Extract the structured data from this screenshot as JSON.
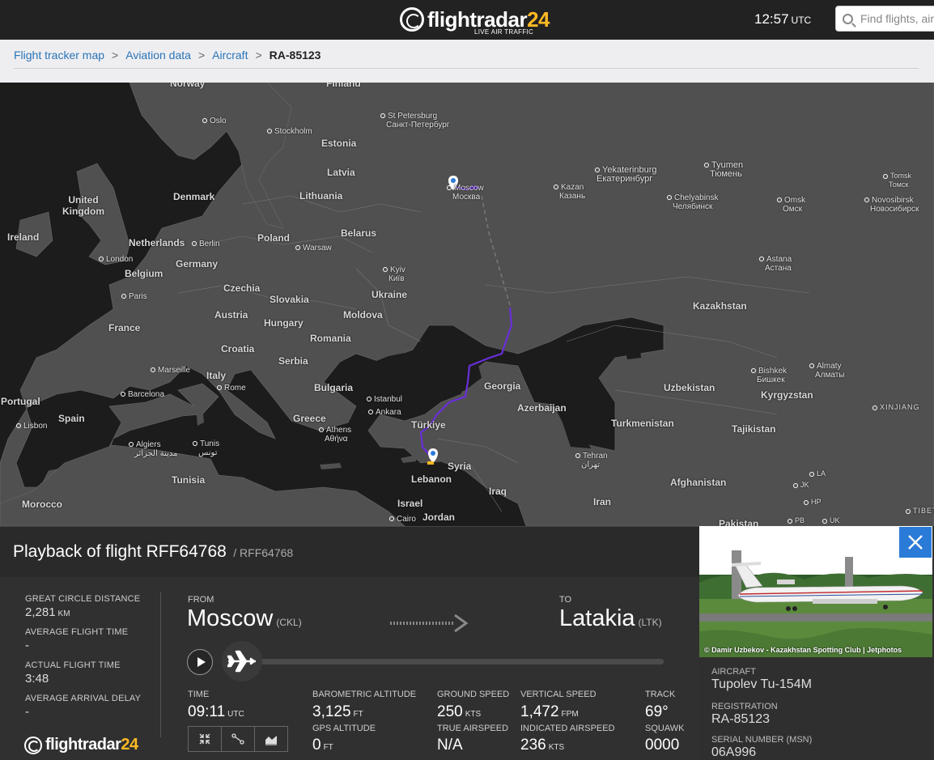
{
  "header": {
    "logo_text": "flightradar",
    "logo_number": "24",
    "logo_tagline": "LIVE AIR TRAFFIC",
    "time": "12:57",
    "time_zone": "UTC",
    "search_placeholder": "Find flights, airports"
  },
  "breadcrumb": {
    "items": [
      "Flight tracker map",
      "Aviation data",
      "Aircraft"
    ],
    "current": "RA-85123",
    "separator": ">"
  },
  "map": {
    "countries": [
      "Norway",
      "Finland",
      "Estonia",
      "Latvia",
      "Lithuania",
      "United Kingdom",
      "Denmark",
      "Ireland",
      "Netherlands",
      "Belarus",
      "Poland",
      "Germany",
      "Belgium",
      "Czechia",
      "Slovakia",
      "Ukraine",
      "France",
      "Austria",
      "Hungary",
      "Moldova",
      "Romania",
      "Croatia",
      "Serbia",
      "Italy",
      "Bulgaria",
      "Georgia",
      "Portugal",
      "Spain",
      "Greece",
      "Türkiye",
      "Azerbaijan",
      "Syria",
      "Lebanon",
      "Iraq",
      "Israel",
      "Jordan",
      "Iran",
      "Tunisia",
      "Morocco",
      "Kazakhstan",
      "Uzbekistan",
      "Kyrgyzstan",
      "Turkmenistan",
      "Tajikistan",
      "Afghanistan",
      "Pakistan"
    ],
    "cities": [
      {
        "name": "Oslo"
      },
      {
        "name": "Stockholm"
      },
      {
        "name": "St Petersburg",
        "local": "Санкт-Петербург"
      },
      {
        "name": "Moscow",
        "local": "Москва"
      },
      {
        "name": "Kazan",
        "local": "Казань"
      },
      {
        "name": "Yekaterinburg",
        "local": "Екатеринбург"
      },
      {
        "name": "Tyumen",
        "local": "Тюмень"
      },
      {
        "name": "Tomsk",
        "local": "Томск"
      },
      {
        "name": "Chelyabinsk",
        "local": "Челябинск"
      },
      {
        "name": "Omsk",
        "local": "Омск"
      },
      {
        "name": "Novosibirsk",
        "local": "Новосибирск"
      },
      {
        "name": "Berlin"
      },
      {
        "name": "London"
      },
      {
        "name": "Warsaw"
      },
      {
        "name": "Kyiv",
        "local": "Київ"
      },
      {
        "name": "Astana",
        "local": "Астана"
      },
      {
        "name": "Paris"
      },
      {
        "name": "Marseille"
      },
      {
        "name": "Rome"
      },
      {
        "name": "Barcelona"
      },
      {
        "name": "Istanbul"
      },
      {
        "name": "Ankara"
      },
      {
        "name": "Athens",
        "local": "Αθήνα"
      },
      {
        "name": "Lisbon"
      },
      {
        "name": "Algiers",
        "local": "مدينة الجزائر"
      },
      {
        "name": "Tunis",
        "local": "تونس"
      },
      {
        "name": "Bishkek",
        "local": "Бишкек"
      },
      {
        "name": "Almaty",
        "local": "Алматы"
      },
      {
        "name": "Tehran",
        "local": "تهران"
      },
      {
        "name": "Cairo"
      }
    ],
    "regions": [
      "XINJIANG",
      "LA",
      "JK",
      "HP",
      "PB",
      "UK",
      "TIBET"
    ]
  },
  "flight": {
    "title": "Playback of flight RFF64768",
    "callsign": "/ RFF64768",
    "stats": [
      {
        "label": "GREAT CIRCLE DISTANCE",
        "value": "2,281",
        "unit": "KM"
      },
      {
        "label": "AVERAGE FLIGHT TIME",
        "value": "-",
        "unit": ""
      },
      {
        "label": "ACTUAL FLIGHT TIME",
        "value": "3:48",
        "unit": ""
      },
      {
        "label": "AVERAGE ARRIVAL DELAY",
        "value": "-",
        "unit": ""
      }
    ],
    "from_label": "FROM",
    "from_city": "Moscow",
    "from_code": "(CKL)",
    "to_label": "TO",
    "to_city": "Latakia",
    "to_code": "(LTK)",
    "playback_progress": 0.0,
    "details": {
      "time_label": "TIME",
      "time_value": "09:11",
      "time_unit": "UTC",
      "baro_alt_label": "BAROMETRIC ALTITUDE",
      "baro_alt_value": "3,125",
      "baro_alt_unit": "FT",
      "gps_alt_label": "GPS ALTITUDE",
      "gps_alt_value": "0",
      "gps_alt_unit": "FT",
      "ground_speed_label": "GROUND SPEED",
      "ground_speed_value": "250",
      "ground_speed_unit": "KTS",
      "true_airspeed_label": "TRUE AIRSPEED",
      "true_airspeed_value": "N/A",
      "vertical_speed_label": "VERTICAL SPEED",
      "vertical_speed_value": "1,472",
      "vertical_speed_unit": "FPM",
      "indicated_airspeed_label": "INDICATED AIRSPEED",
      "indicated_airspeed_value": "236",
      "indicated_airspeed_unit": "KTS",
      "track_label": "TRACK",
      "track_value": "69°",
      "squawk_label": "SQUAWK",
      "squawk_value": "0000"
    },
    "footer_logo_text": "flightradar",
    "footer_logo_number": "24"
  },
  "aircraft": {
    "photo_credit": "© Damir Uzbekov - Kazakhstan Spotting Club | Jetphotos",
    "aircraft_label": "AIRCRAFT",
    "aircraft_value": "Tupolev Tu-154M",
    "registration_label": "REGISTRATION",
    "registration_value": "RA-85123",
    "serial_label": "SERIAL NUMBER (MSN)",
    "serial_value": "06A996"
  },
  "colors": {
    "accent": "#fdb924",
    "link": "#2a74b6",
    "track_purple": "#6a2ed8",
    "close_button": "#2a7bd8"
  }
}
